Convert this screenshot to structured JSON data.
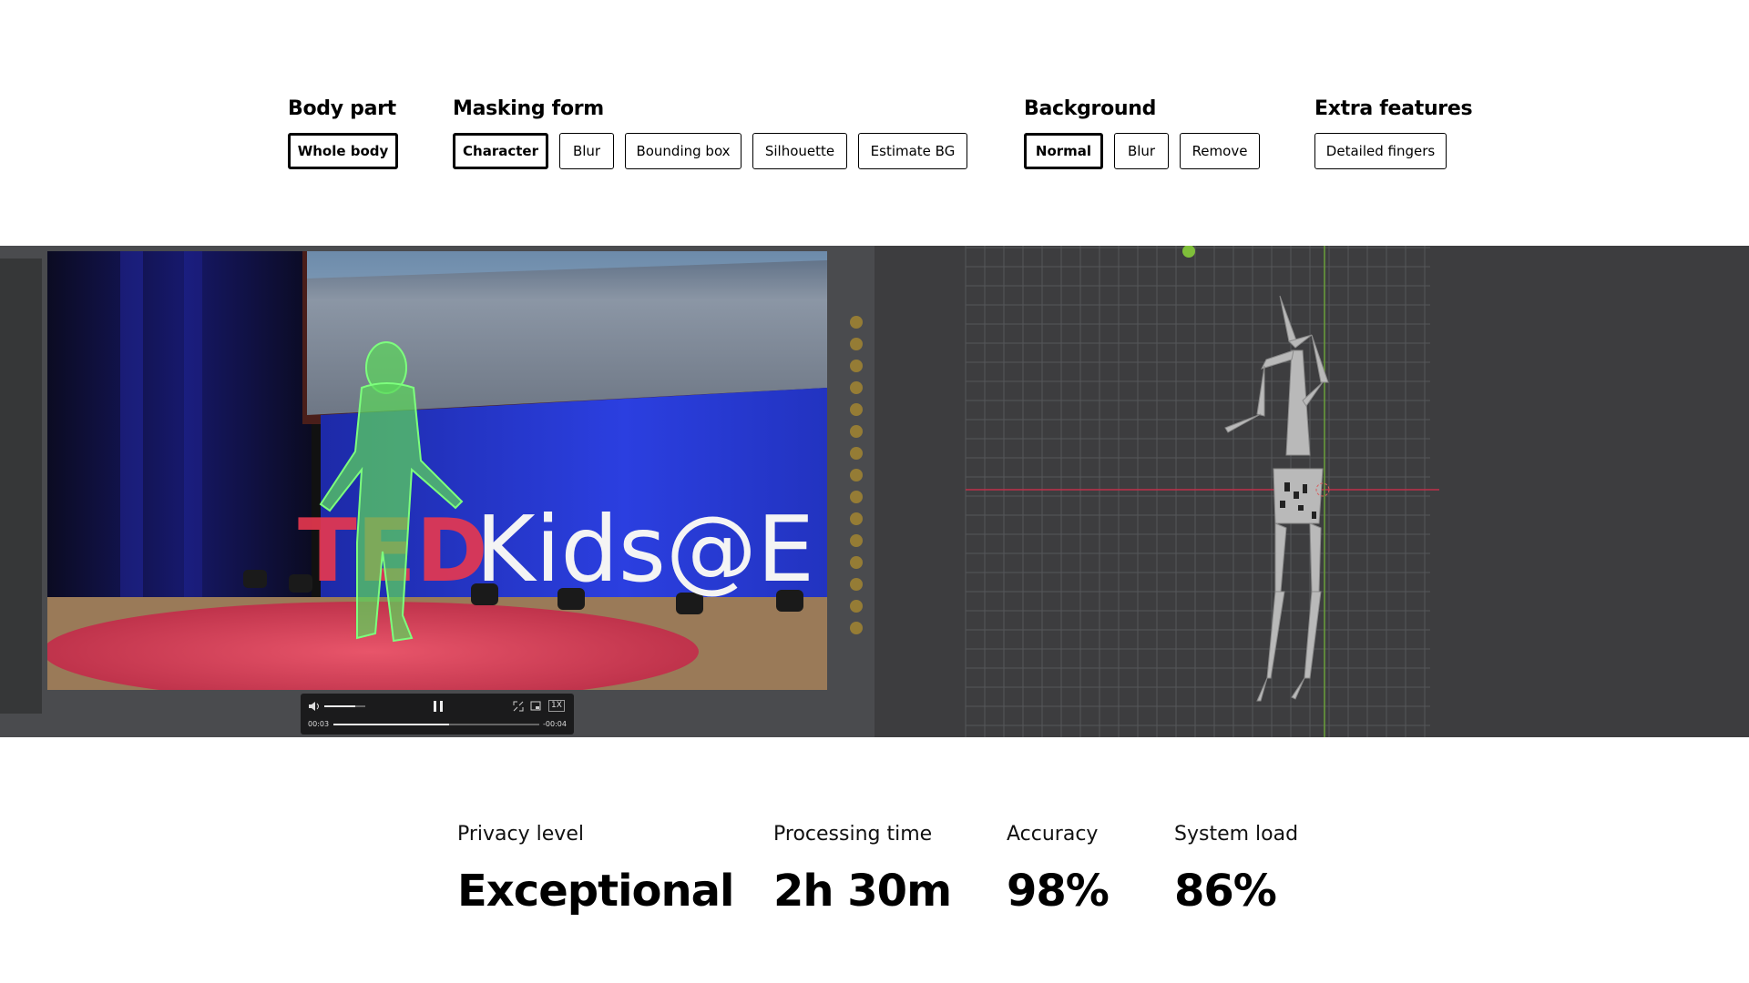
{
  "controls": {
    "body_part": {
      "title": "Body part",
      "options": [
        "Whole body"
      ]
    },
    "masking_form": {
      "title": "Masking form",
      "options": [
        "Character",
        "Blur",
        "Bounding box",
        "Silhouette",
        "Estimate BG"
      ]
    },
    "background": {
      "title": "Background",
      "options": [
        "Normal",
        "Blur",
        "Remove"
      ]
    },
    "extra_features": {
      "title": "Extra features",
      "options": [
        "Detailed fingers"
      ]
    }
  },
  "video": {
    "sign_text": "Kids@E",
    "sign_prefix": "TED",
    "player": {
      "elapsed": "00:03",
      "remaining": "-00:04",
      "speed": "1X",
      "progress": 0.56,
      "volume": 0.75
    }
  },
  "stats": [
    {
      "label": "Privacy level",
      "value": "Exceptional"
    },
    {
      "label": "Processing time",
      "value": "2h 30m"
    },
    {
      "label": "Accuracy",
      "value": "98%"
    },
    {
      "label": "System load",
      "value": "86%"
    }
  ],
  "colors": {
    "mask_green": "#5bd65b",
    "stage_red": "#d8364f",
    "backdrop_blue": "#2b3fe0",
    "viewport_bg": "#3d3d3f"
  },
  "icons": {
    "play_state": "pause-icon",
    "volume": "volume-icon",
    "fullscreen": "fullscreen-icon",
    "pip": "picture-in-picture-icon"
  }
}
